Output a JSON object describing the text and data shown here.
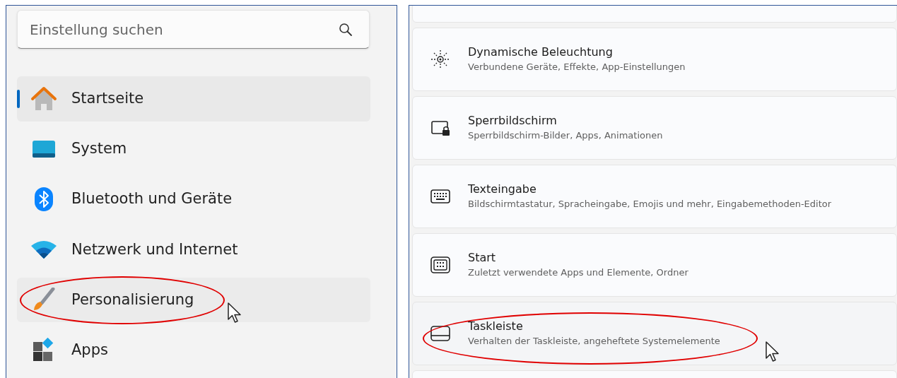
{
  "sidebar": {
    "search": {
      "placeholder": "Einstellung suchen"
    },
    "items": [
      {
        "label": "Startseite",
        "selected": true,
        "hovered": false,
        "circled": false
      },
      {
        "label": "System",
        "selected": false,
        "hovered": false,
        "circled": false
      },
      {
        "label": "Bluetooth und Geräte",
        "selected": false,
        "hovered": false,
        "circled": false
      },
      {
        "label": "Netzwerk und Internet",
        "selected": false,
        "hovered": false,
        "circled": false
      },
      {
        "label": "Personalisierung",
        "selected": false,
        "hovered": true,
        "circled": true
      },
      {
        "label": "Apps",
        "selected": false,
        "hovered": false,
        "circled": false
      }
    ]
  },
  "settings": [
    {
      "title": "Dynamische Beleuchtung",
      "subtitle": "Verbundene Geräte, Effekte, App-Einstellungen",
      "hovered": false,
      "circled": false
    },
    {
      "title": "Sperrbildschirm",
      "subtitle": "Sperrbildschirm-Bilder, Apps, Animationen",
      "hovered": false,
      "circled": false
    },
    {
      "title": "Texteingabe",
      "subtitle": "Bildschirmtastatur, Spracheingabe, Emojis und mehr, Eingabemethoden-Editor",
      "hovered": false,
      "circled": false
    },
    {
      "title": "Start",
      "subtitle": "Zuletzt verwendete Apps und Elemente, Ordner",
      "hovered": false,
      "circled": false
    },
    {
      "title": "Taskleiste",
      "subtitle": "Verhalten der Taskleiste, angeheftete Systemelemente",
      "hovered": true,
      "circled": true
    }
  ]
}
